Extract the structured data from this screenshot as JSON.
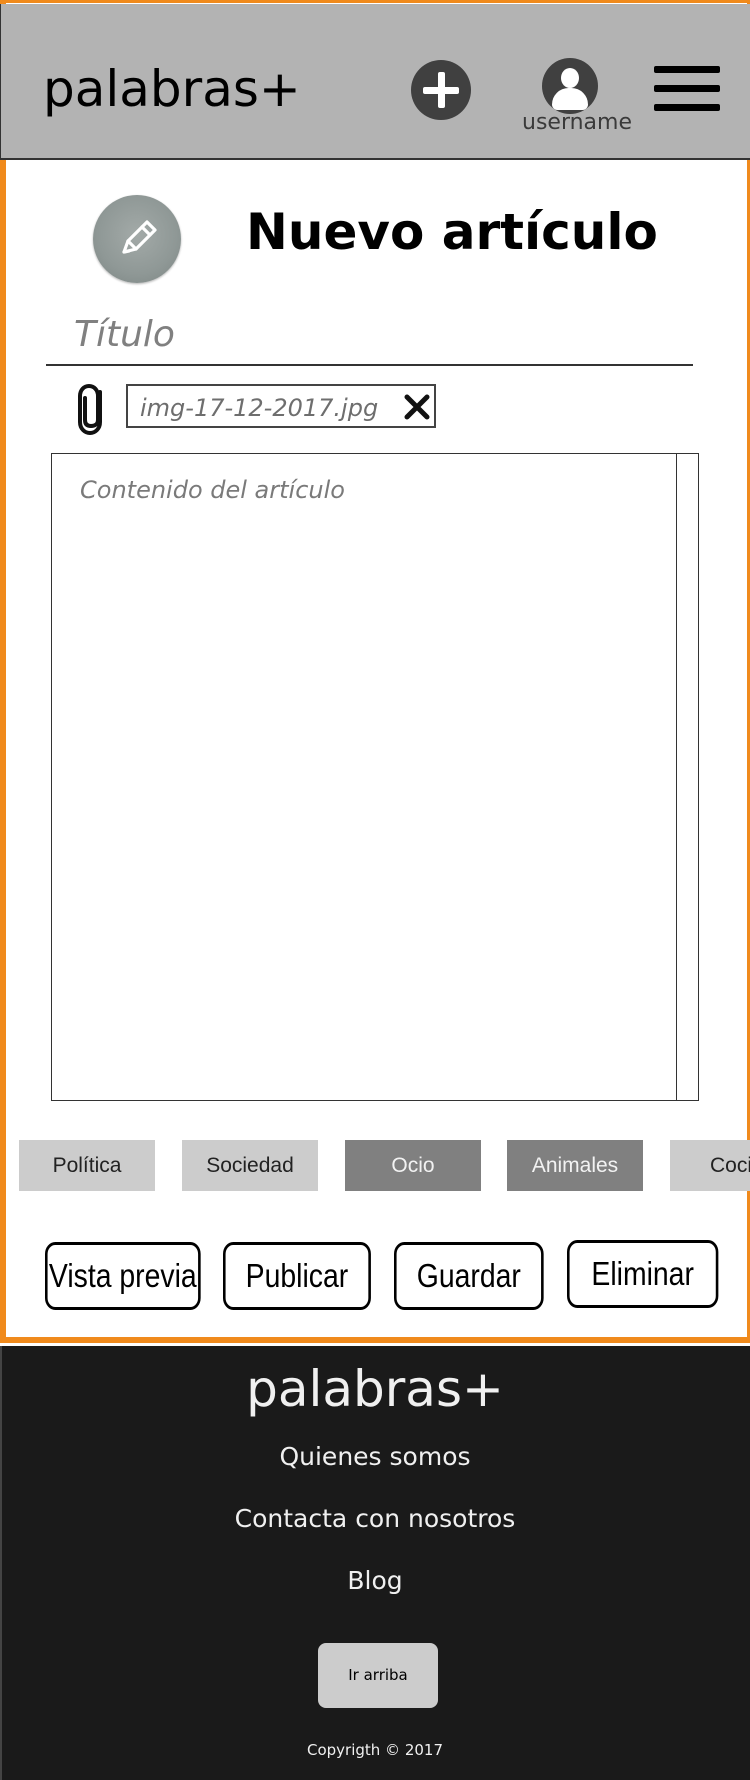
{
  "header": {
    "logo": "palabras+",
    "username": "username"
  },
  "editor": {
    "page_title": "Nuevo artículo",
    "title_placeholder": "Título",
    "attachment_name": "img-17-12-2017.jpg",
    "content_placeholder": "Contenido del artículo"
  },
  "categories": [
    {
      "label": "Política",
      "selected": false
    },
    {
      "label": "Sociedad",
      "selected": false
    },
    {
      "label": "Ocio",
      "selected": true
    },
    {
      "label": "Animales",
      "selected": true
    },
    {
      "label": "Cocina",
      "selected": false
    }
  ],
  "actions": {
    "preview": "Vista previa",
    "publish": "Publicar",
    "save": "Guardar",
    "delete": "Eliminar"
  },
  "footer": {
    "logo": "palabras+",
    "links": [
      "Quienes somos",
      "Contacta con nosotros",
      "Blog"
    ],
    "top_button": "Ir arriba",
    "copyright": "Copyrigth © 2017"
  },
  "colors": {
    "frame": "#f08a1c",
    "header": "#b3b3b3",
    "footer": "#1a1a1a",
    "category_selected": "#808080",
    "category_default": "#cccccc"
  },
  "icons": [
    "plus-icon",
    "user-avatar-icon",
    "menu-icon",
    "pencil-icon",
    "paperclip-icon",
    "close-icon"
  ]
}
